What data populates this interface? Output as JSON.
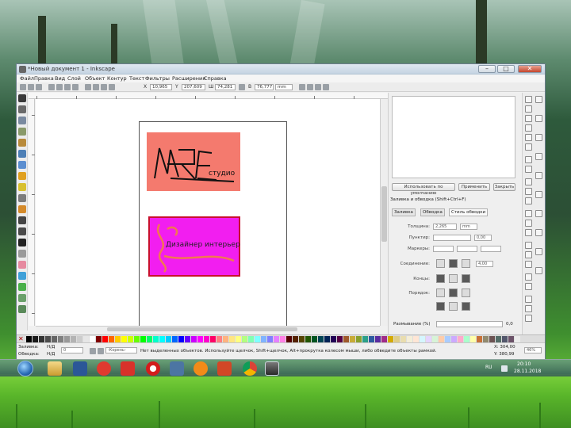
{
  "window": {
    "title": "*Новый документ 1 - Inkscape",
    "minimize": "–",
    "maximize": "□",
    "close": "✕"
  },
  "menu": [
    "Файл",
    "Правка",
    "Вид",
    "Слой",
    "Объект",
    "Контур",
    "Текст",
    "Фильтры",
    "Расширения",
    "Справка"
  ],
  "toolbar": {
    "x_label": "X",
    "x_value": "10,965",
    "y_label": "Y",
    "y_value": "207,609",
    "w_label": "Ш",
    "w_value": "74,281",
    "h_label": "В",
    "h_value": "76,777",
    "unit": "mm"
  },
  "canvas": {
    "logo_text": "студио",
    "card2_text": "Дизайнер интерьер",
    "colors": {
      "card1_fill": "#f47a6e",
      "card2_fill": "#f21ef0",
      "card2_border": "#c8102e",
      "swirl": "#f2784f"
    }
  },
  "panel": {
    "btn_default": "Использовать по умолчанию",
    "btn_apply": "Применить",
    "btn_close": "Закрыть",
    "header": "Заливка и обводка (Shift+Ctrl+F)",
    "tabs": [
      "Заливка",
      "Обводка",
      "Стиль обводки"
    ],
    "labels": {
      "width": "Толщина:",
      "dashes": "Пунктир:",
      "markers": "Маркеры:",
      "join": "Соединение:",
      "cap": "Концы:",
      "order": "Порядок:"
    },
    "width_value": "2,265",
    "width_unit": "mm",
    "dash_value": "0,00",
    "join_value": "4,00",
    "blur_label": "Размывание (%)",
    "blur_value": "0,0"
  },
  "statusbar": {
    "fill_label": "Заливка:",
    "stroke_label": "Обводка:",
    "fill_value": "Н/Д",
    "stroke_value": "Н/Д",
    "stroke_width": "0",
    "layer": "-Корень-",
    "message": "Нет выделенных объектов. Используйте щелчок, Shift+щелчок, Alt+прокрутка колесом мыши, либо обведите объекты рамкой.",
    "x_coord": "X: 304,00",
    "y_coord": "Y: 380,99",
    "zoom": "46%"
  },
  "taskbar": {
    "apps": [
      "explorer",
      "word",
      "yandex",
      "yandex-browser",
      "opera",
      "vk",
      "mail",
      "powerpoint",
      "chrome",
      "inkscape"
    ],
    "lang": "RU",
    "time": "20:10",
    "date": "28.11.2018"
  }
}
